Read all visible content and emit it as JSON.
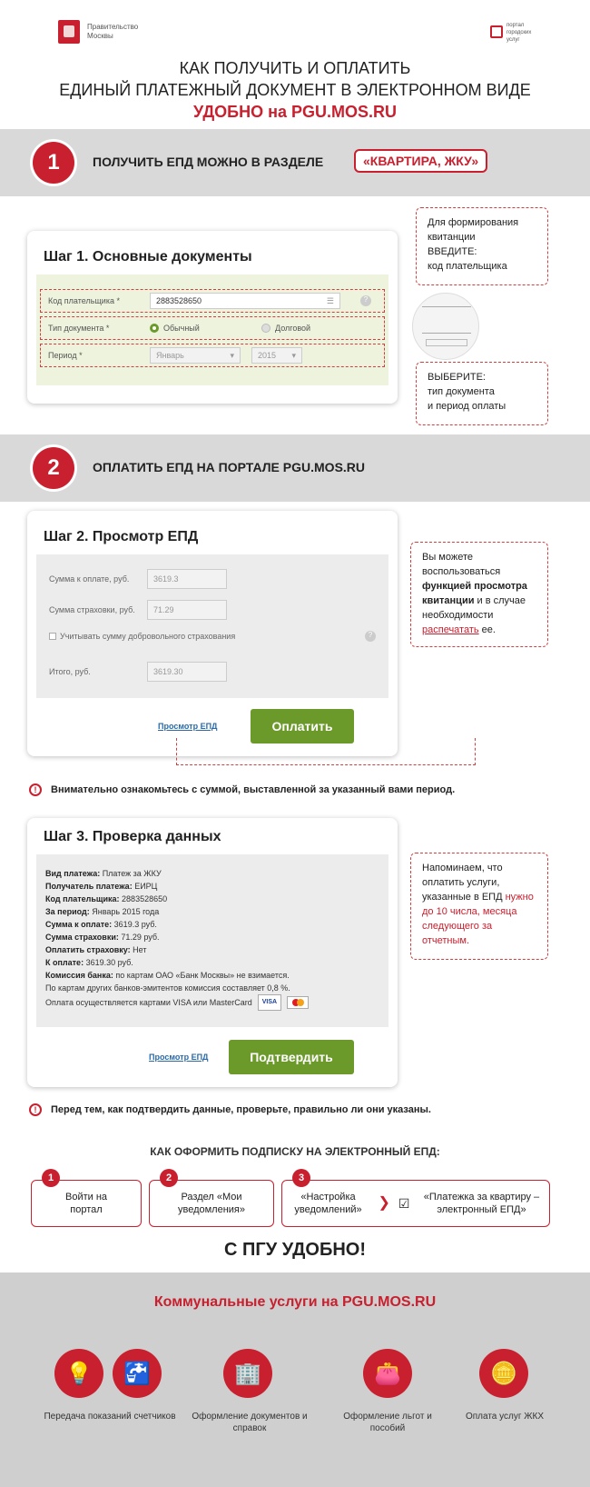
{
  "header": {
    "org_name": "Правительство Москвы",
    "portal_name": "портал городских услуг",
    "title_line1": "КАК ПОЛУЧИТЬ И ОПЛАТИТЬ",
    "title_line2": "ЕДИНЫЙ ПЛАТЕЖНЫЙ ДОКУМЕНТ В ЭЛЕКТРОННОМ ВИДЕ",
    "title_line3": "УДОБНО на PGU.MOS.RU"
  },
  "step1": {
    "num": "1",
    "band_text": "ПОЛУЧИТЬ ЕПД МОЖНО В РАЗДЕЛЕ",
    "tag": "«КВАРТИРА, ЖКУ»",
    "card_title": "Шаг 1. Основные документы",
    "payer_label": "Код плательщика *",
    "payer_value": "2883528650",
    "doctype_label": "Тип документа *",
    "doctype_opt1": "Обычный",
    "doctype_opt2": "Долговой",
    "period_label": "Период *",
    "month": "Январь",
    "year": "2015",
    "note1_line1": "Для формирования",
    "note1_line2": "квитанции",
    "note1_line3": "ВВЕДИТЕ:",
    "note1_line4": "код плательщика",
    "note2_line1": "ВЫБЕРИТЕ:",
    "note2_line2": "тип документа",
    "note2_line3": "и период оплаты"
  },
  "step2": {
    "num": "2",
    "band_text": "ОПЛАТИТЬ ЕПД НА ПОРТАЛЕ PGU.MOS.RU",
    "card_title": "Шаг 2. Просмотр ЕПД",
    "sum_label": "Сумма к оплате, руб.",
    "sum_value": "3619.3",
    "ins_label": "Сумма страховки, руб.",
    "ins_value": "71.29",
    "checkbox_label": "Учитывать сумму добровольного страхования",
    "total_label": "Итого, руб.",
    "total_value": "3619.30",
    "view_link": "Просмотр ЕПД",
    "pay_button": "Оплатить",
    "note_part1": "Вы можете воспользоваться ",
    "note_bold": "функцией просмотра квитанции",
    "note_part2": " и в случае необходимости ",
    "note_red": "распечатать",
    "note_part3": " ее."
  },
  "warning1": "Внимательно ознакомьтесь с суммой, выставленной за указанный вами период.",
  "step3": {
    "card_title": "Шаг 3. Проверка данных",
    "lines": [
      {
        "k": "Вид платежа:",
        "v": " Платеж за ЖКУ"
      },
      {
        "k": "Получатель платежа:",
        "v": " ЕИРЦ"
      },
      {
        "k": "Код плательщика:",
        "v": " 2883528650"
      },
      {
        "k": "За период:",
        "v": " Январь 2015 года"
      },
      {
        "k": "Сумма к оплате:",
        "v": " 3619.3 руб."
      },
      {
        "k": "Сумма страховки:",
        "v": " 71.29 руб."
      },
      {
        "k": "Оплатить страховку:",
        "v": " Нет"
      },
      {
        "k": "К оплате:",
        "v": " 3619.30 руб."
      },
      {
        "k": "Комиссия банка:",
        "v": " по картам ОАО «Банк Москвы» не взимается."
      }
    ],
    "commission_other": "По картам других банков-эмитентов комиссия составляет 0,8 %.",
    "cards_text": "Оплата осуществляется картами VISA или MasterCard",
    "visa": "VISA",
    "view_link": "Просмотр ЕПД",
    "confirm_button": "Подтвердить",
    "note_part1": "Напоминаем, что оплатить услуги, указанные в ЕПД ",
    "note_red": "нужно до 10 числа, месяца следующего за отчетным."
  },
  "warning2": "Перед тем, как подтвердить данные, проверьте, правильно ли они указаны.",
  "subscribe": {
    "title": "КАК ОФОРМИТЬ ПОДПИСКУ НА ЭЛЕКТРОННЫЙ ЕПД:",
    "s1_num": "1",
    "s1_text": "Войти на портал",
    "s2_num": "2",
    "s2_text": "Раздел «Мои уведомления»",
    "s3_num": "3",
    "s3_text_a": "«Настройка уведомлений»",
    "s3_text_b": "«Платежка за квартиру – электронный ЕПД»"
  },
  "slogan": "С ПГУ УДОБНО!",
  "footer": {
    "title": "Коммунальные услуги на PGU.MOS.RU",
    "services": [
      {
        "label": "Передача показаний счетчиков",
        "icon": "bulb-icon"
      },
      {
        "label": "Оформление документов и справок",
        "icon": "building-icon"
      },
      {
        "label": "Оформление льгот и пособий",
        "icon": "wallet-icon"
      },
      {
        "label": "Оплата услуг ЖКХ",
        "icon": "coins-icon"
      }
    ]
  },
  "colors": {
    "accent": "#c8202e",
    "green": "#6b9a2a",
    "band": "#d9d9d9"
  }
}
